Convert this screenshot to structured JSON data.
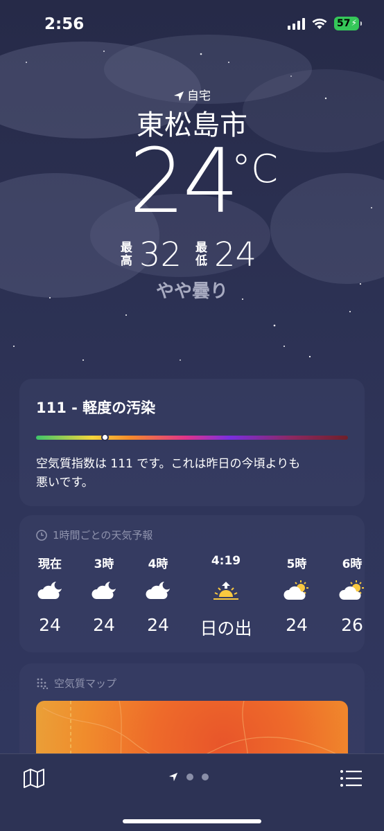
{
  "status_bar": {
    "time": "2:56",
    "battery": "57"
  },
  "location": {
    "label": "自宅",
    "city": "東松島市"
  },
  "current": {
    "temp": "24",
    "unit": "°C",
    "high_label_top": "最",
    "high_label_bottom": "高",
    "high": "32",
    "low_label_top": "最",
    "low_label_bottom": "低",
    "low": "24",
    "condition": "やや曇り"
  },
  "air_quality": {
    "title": "111 - 軽度の汚染",
    "description_line1": "空気質指数は 111 です。これは昨日の今頃よりも",
    "description_line2": "悪いです。",
    "level_fraction": 0.22
  },
  "hourly": {
    "header": "1時間ごとの天気予報",
    "items": [
      {
        "time": "現在",
        "icon": "moon-cloud-icon",
        "temp": "24"
      },
      {
        "time": "3時",
        "icon": "moon-cloud-icon",
        "temp": "24"
      },
      {
        "time": "4時",
        "icon": "moon-cloud-icon",
        "temp": "24"
      },
      {
        "time": "4:19",
        "icon": "sunrise-icon",
        "temp": "日の出"
      },
      {
        "time": "5時",
        "icon": "sun-cloud-icon",
        "temp": "24"
      },
      {
        "time": "6時",
        "icon": "sun-cloud-icon",
        "temp": "26"
      }
    ]
  },
  "aq_map": {
    "header": "空気質マップ"
  },
  "colors": {
    "aqi_green": "#3ec56a",
    "map_orange": "#ee6a2a",
    "battery": "#35c759"
  }
}
